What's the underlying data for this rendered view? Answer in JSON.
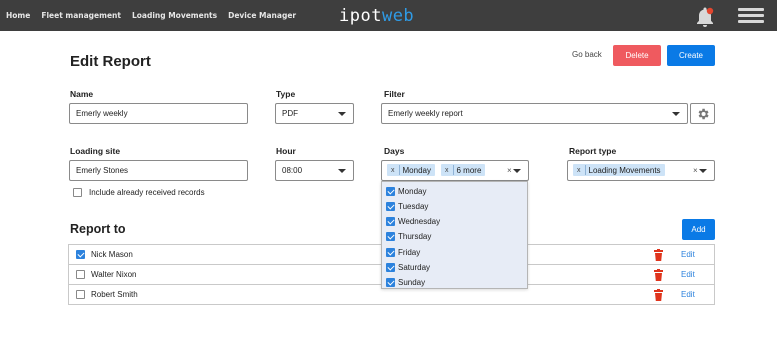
{
  "nav": {
    "items": [
      "Home",
      "Fleet management",
      "Loading Movements",
      "Device Manager"
    ],
    "logo_part1": "ipot",
    "logo_part2": "web"
  },
  "colors": {
    "accent": "#0a7ae6",
    "danger": "#ef5a5f",
    "topbar": "#3e3e3e",
    "tag": "#cde3f7",
    "dropdown_bg": "#e7ecf6"
  },
  "page": {
    "title": "Edit Report",
    "go_back": "Go back",
    "delete_label": "Delete",
    "create_label": "Create"
  },
  "form": {
    "name_label": "Name",
    "name_value": "Emerly weekly",
    "type_label": "Type",
    "type_value": "PDF",
    "filter_label": "Filter",
    "filter_value": "Emerly weekly report",
    "loading_site_label": "Loading site",
    "loading_site_value": "Emerly Stones",
    "hour_label": "Hour",
    "hour_value": "08:00",
    "days_label": "Days",
    "days_tags": [
      "Monday",
      "6 more"
    ],
    "report_type_label": "Report type",
    "report_type_tag": "Loading Movements",
    "include_received_label": "Include already received records",
    "include_received_checked": false,
    "tag_remove_glyph": "x",
    "clear_glyph": "×"
  },
  "days_options": [
    {
      "label": "Monday",
      "checked": true
    },
    {
      "label": "Tuesday",
      "checked": true
    },
    {
      "label": "Wednesday",
      "checked": true
    },
    {
      "label": "Thursday",
      "checked": true
    },
    {
      "label": "Friday",
      "checked": true
    },
    {
      "label": "Saturday",
      "checked": true
    },
    {
      "label": "Sunday",
      "checked": true
    }
  ],
  "report_to": {
    "title": "Report to",
    "add_label": "Add",
    "edit_label": "Edit",
    "rows": [
      {
        "name": "Nick Mason",
        "checked": true
      },
      {
        "name": "Walter Nixon",
        "checked": false
      },
      {
        "name": "Robert Smith",
        "checked": false
      }
    ]
  },
  "icons": {
    "bell": "bell-icon",
    "menu": "hamburger-menu-icon",
    "gear": "gear-icon",
    "trash": "trash-icon",
    "caret": "chevron-down-icon"
  }
}
